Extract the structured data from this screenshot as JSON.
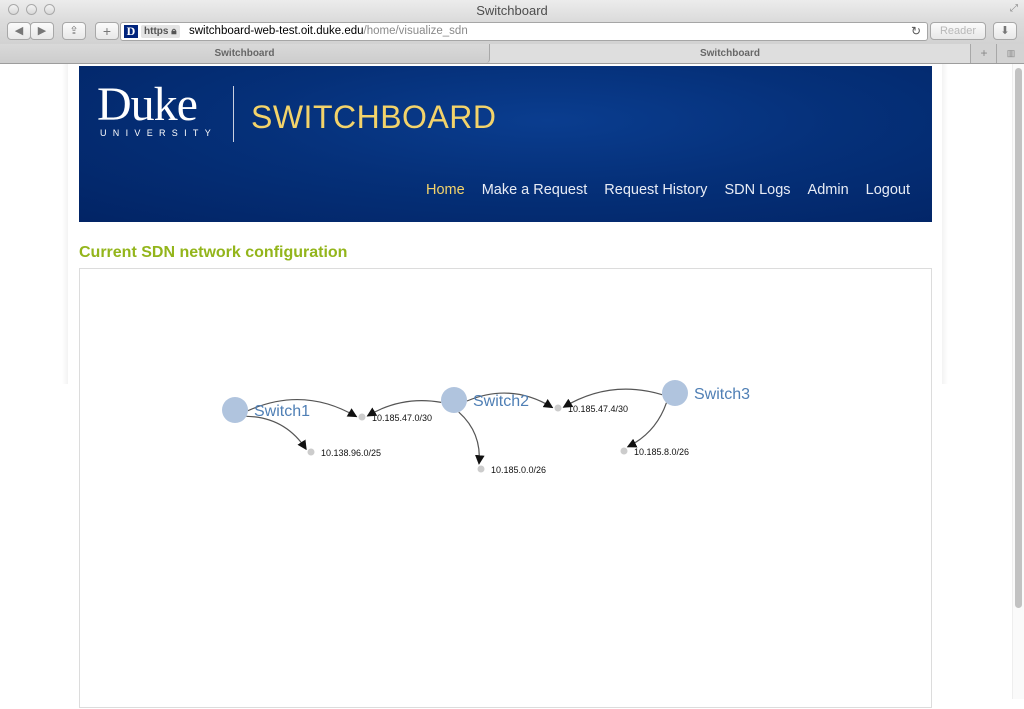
{
  "window": {
    "title": "Switchboard",
    "url_host": "switchboard-web-test.oit.duke.edu",
    "url_path": "/home/visualize_sdn",
    "https_label": "https",
    "reader_label": "Reader",
    "favicon_letter": "D"
  },
  "tabs": [
    {
      "label": "Switchboard",
      "active": true
    },
    {
      "label": "Switchboard",
      "active": false
    }
  ],
  "header": {
    "brand_word": "Duke",
    "brand_sub": "UNIVERSITY",
    "app_title": "SWITCHBOARD",
    "nav": [
      {
        "label": "Home",
        "active": true
      },
      {
        "label": "Make a Request",
        "active": false
      },
      {
        "label": "Request History",
        "active": false
      },
      {
        "label": "SDN Logs",
        "active": false
      },
      {
        "label": "Admin",
        "active": false
      },
      {
        "label": "Logout",
        "active": false
      }
    ]
  },
  "colors": {
    "header_bg": "#053079",
    "brand_gold": "#f3d36a",
    "section_green": "#93b51b",
    "switch_node": "#b0c4de",
    "switch_label": "#4f7fb5",
    "subnet_node": "#cccccc"
  },
  "main": {
    "section_title": "Current SDN network configuration"
  },
  "network": {
    "switches": [
      {
        "id": "s1",
        "label": "Switch1"
      },
      {
        "id": "s2",
        "label": "Switch2"
      },
      {
        "id": "s3",
        "label": "Switch3"
      }
    ],
    "subnets": [
      {
        "id": "n1",
        "label": "10.185.47.0/30"
      },
      {
        "id": "n2",
        "label": "10.138.96.0/25"
      },
      {
        "id": "n3",
        "label": "10.185.47.4/30"
      },
      {
        "id": "n4",
        "label": "10.185.0.0/26"
      },
      {
        "id": "n5",
        "label": "10.185.8.0/26"
      }
    ],
    "links": [
      {
        "from": "s1",
        "to": "n1"
      },
      {
        "from": "s1",
        "to": "n2"
      },
      {
        "from": "s2",
        "to": "n1"
      },
      {
        "from": "s2",
        "to": "n3"
      },
      {
        "from": "s2",
        "to": "n4"
      },
      {
        "from": "s3",
        "to": "n3"
      },
      {
        "from": "s3",
        "to": "n5"
      }
    ]
  }
}
